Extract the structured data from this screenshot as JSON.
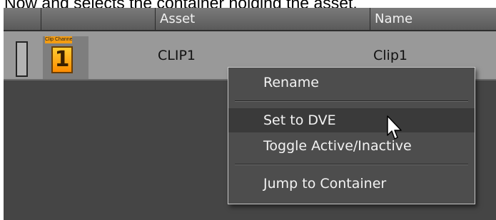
{
  "caption": "Now and selects the container holding the asset.",
  "table": {
    "columns": [
      "",
      "",
      "Asset",
      "Name"
    ],
    "rows": [
      {
        "thumb_label": "Clip Channel",
        "thumb_number": "1",
        "asset": "CLIP1",
        "name": "Clip1"
      }
    ]
  },
  "context_menu": {
    "items": [
      {
        "label": "Rename"
      },
      {
        "label": "Set to DVE"
      },
      {
        "label": "Toggle Active/Inactive"
      },
      {
        "label": "Jump to Container"
      }
    ],
    "highlighted_index": 1
  },
  "icons": [
    "mouse-cursor-icon"
  ],
  "colors": {
    "panel_bg": "#454545",
    "row_bg": "#999999",
    "menu_bg": "#4d4d4d",
    "menu_highlight": "#3a3a3a",
    "thumb_accent": "#f39c12"
  }
}
